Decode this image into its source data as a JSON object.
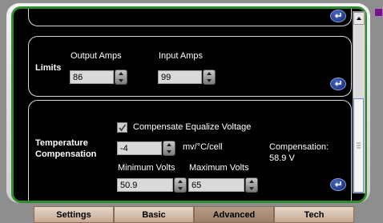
{
  "limits": {
    "section_label": "Limits",
    "output_amps_label": "Output Amps",
    "output_amps_value": "86",
    "input_amps_label": "Input Amps",
    "input_amps_value": "99"
  },
  "temperature": {
    "section_label_line1": "Temperature",
    "section_label_line2": "Compensation",
    "checkbox_label": "Compensate Equalize Voltage",
    "checkbox_checked": true,
    "coefficient_value": "-4",
    "coefficient_unit": "mv/°C/cell",
    "compensation_label": "Compensation:",
    "compensation_value": "58.9 V",
    "min_volts_label": "Minimum Volts",
    "min_volts_value": "50.9",
    "max_volts_label": "Maximum Volts",
    "max_volts_value": "65"
  },
  "tabs": [
    {
      "label": "Settings",
      "active": false
    },
    {
      "label": "Basic",
      "active": false
    },
    {
      "label": "Advanced",
      "active": true
    },
    {
      "label": "Tech",
      "active": false
    }
  ],
  "colors": {
    "frame_border": "#2e8b2e",
    "background": "#000000",
    "enter_button": "#112466"
  }
}
